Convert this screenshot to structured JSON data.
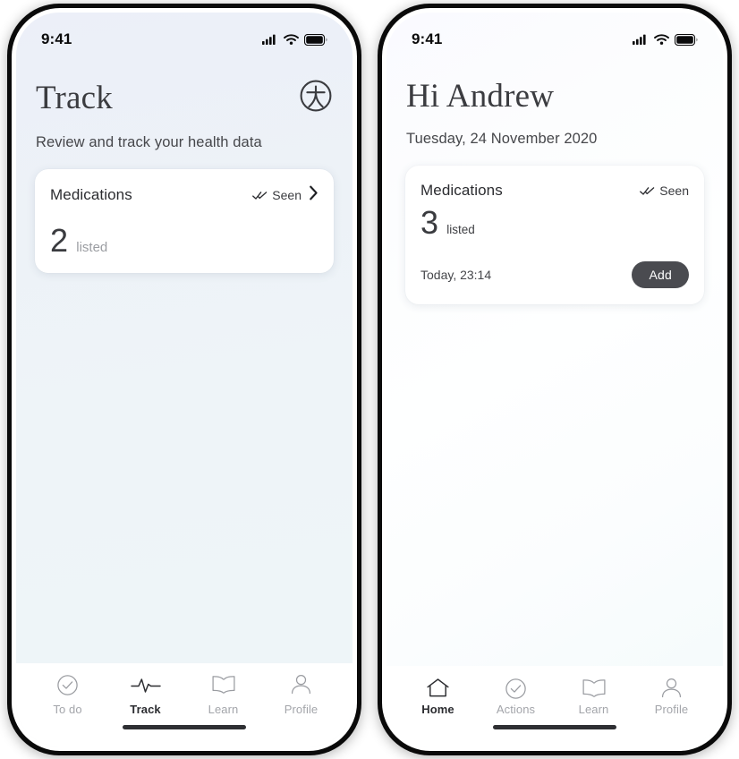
{
  "colors": {
    "accent_dark": "#4a4b50",
    "text_primary": "#2b2c30",
    "text_muted": "#a3a5aa",
    "card_bg": "#ffffff",
    "screen_left_bg": "#eef3f8",
    "screen_right_bg": "#fbfdfe"
  },
  "phones": [
    {
      "id": "track-screen",
      "status_bar": {
        "time": "9:41",
        "icons": [
          "cellular-signal-icon",
          "wifi-icon",
          "battery-icon"
        ]
      },
      "header": {
        "title": "Track",
        "logo_icon": "brand-logo-icon",
        "subtitle": "Review and track your health data"
      },
      "card": {
        "title": "Medications",
        "status_icon": "double-check-icon",
        "status_label": "Seen",
        "chevron_icon": "chevron-right-icon",
        "metric_value": "2",
        "metric_unit": "listed",
        "has_footer": false
      },
      "tabs": [
        {
          "label": "To do",
          "icon": "check-circle-icon",
          "active": false
        },
        {
          "label": "Track",
          "icon": "pulse-icon",
          "active": true
        },
        {
          "label": "Learn",
          "icon": "book-icon",
          "active": false
        },
        {
          "label": "Profile",
          "icon": "person-icon",
          "active": false
        }
      ]
    },
    {
      "id": "home-screen",
      "status_bar": {
        "time": "9:41",
        "icons": [
          "cellular-signal-icon",
          "wifi-icon",
          "battery-icon"
        ]
      },
      "header": {
        "title": "Hi Andrew",
        "logo_icon": null,
        "subtitle": "Tuesday, 24 November 2020"
      },
      "card": {
        "title": "Medications",
        "status_icon": "double-check-icon",
        "status_label": "Seen",
        "chevron_icon": null,
        "metric_value": "3",
        "metric_unit": "listed",
        "has_footer": true,
        "timestamp": "Today, 23:14",
        "action_label": "Add"
      },
      "tabs": [
        {
          "label": "Home",
          "icon": "home-icon",
          "active": true
        },
        {
          "label": "Actions",
          "icon": "check-circle-icon",
          "active": false
        },
        {
          "label": "Learn",
          "icon": "book-icon",
          "active": false
        },
        {
          "label": "Profile",
          "icon": "person-icon",
          "active": false
        }
      ]
    }
  ]
}
